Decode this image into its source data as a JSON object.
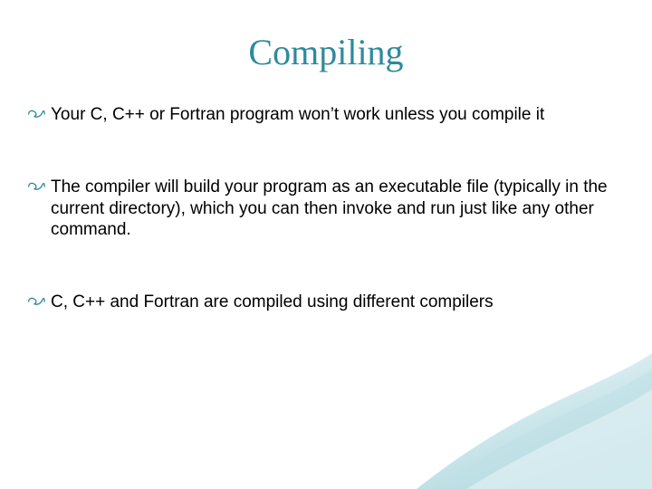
{
  "slide": {
    "title": "Compiling",
    "bullets": [
      {
        "text": "Your C, C++ or Fortran program won’t work unless you compile it"
      },
      {
        "text": "The compiler will build your program as an executable file (typically in the current directory), which you can then invoke and run just like any other command."
      },
      {
        "text": "C, C++ and Fortran are compiled using different compilers"
      }
    ]
  },
  "theme": {
    "accent": "#2f8a9c",
    "corner_gradient_start": "#c7e5ea",
    "corner_gradient_end": "#ffffff"
  }
}
